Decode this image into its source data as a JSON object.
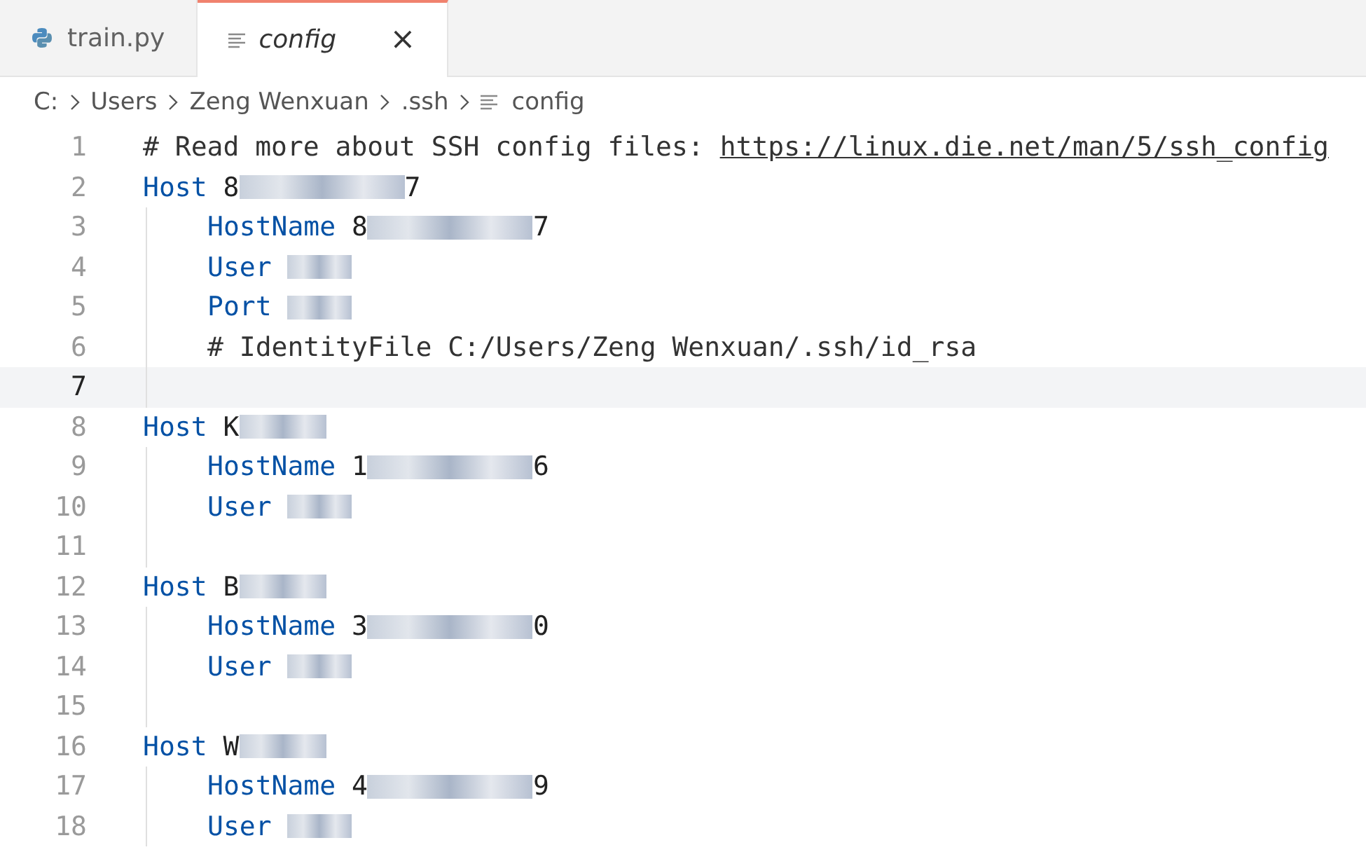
{
  "tabs": [
    {
      "label": "train.py",
      "kind": "python",
      "italic": false,
      "selected": false,
      "closable": false
    },
    {
      "label": "config",
      "kind": "plain",
      "italic": true,
      "selected": true,
      "closable": true,
      "close": "×"
    }
  ],
  "breadcrumb": [
    {
      "label": "C:",
      "icon": false
    },
    {
      "label": "Users",
      "icon": false
    },
    {
      "label": "Zeng Wenxuan",
      "icon": false
    },
    {
      "label": ".ssh",
      "icon": false
    },
    {
      "label": "config",
      "icon": true
    }
  ],
  "lines": [
    {
      "number": "1",
      "kind": "comment",
      "text": "# Read more about SSH config files: ",
      "link": "https://linux.die.net/man/5/ssh_config",
      "selected": false
    },
    {
      "number": "2",
      "kind": "host",
      "keyword": "Host",
      "value_start": "8",
      "redacted": true,
      "value_end": "7",
      "selected": false
    },
    {
      "number": "3",
      "kind": "option",
      "keyword": "HostName",
      "value_start": "8",
      "redacted": true,
      "value_end": "7",
      "selected": false
    },
    {
      "number": "4",
      "kind": "option",
      "keyword": "User",
      "redacted": true,
      "selected": false
    },
    {
      "number": "5",
      "kind": "option",
      "keyword": "Port",
      "redacted": true,
      "selected": false
    },
    {
      "number": "6",
      "kind": "option_comment",
      "text": "# IdentityFile C:/Users/Zeng Wenxuan/.ssh/id_rsa",
      "selected": false
    },
    {
      "number": "7",
      "kind": "blank",
      "selected": true
    },
    {
      "number": "8",
      "kind": "host",
      "keyword": "Host",
      "value_start": "K",
      "redacted": true,
      "selected": false
    },
    {
      "number": "9",
      "kind": "option",
      "keyword": "HostName",
      "value_start": "1",
      "redacted": true,
      "value_end": "6",
      "selected": false
    },
    {
      "number": "10",
      "kind": "option",
      "keyword": "User",
      "redacted": true,
      "selected": false
    },
    {
      "number": "11",
      "kind": "blank",
      "selected": false
    },
    {
      "number": "12",
      "kind": "host",
      "keyword": "Host",
      "value_start": "B",
      "redacted": true,
      "selected": false
    },
    {
      "number": "13",
      "kind": "option",
      "keyword": "HostName",
      "value_start": "3",
      "redacted": true,
      "value_end": "0",
      "selected": false
    },
    {
      "number": "14",
      "kind": "option",
      "keyword": "User",
      "redacted": true,
      "selected": false
    },
    {
      "number": "15",
      "kind": "blank",
      "selected": false
    },
    {
      "number": "16",
      "kind": "host",
      "keyword": "Host",
      "value_start": "W",
      "redacted": true,
      "selected": false
    },
    {
      "number": "17",
      "kind": "option",
      "keyword": "HostName",
      "value_start": "4",
      "redacted": true,
      "value_end": "9",
      "selected": false
    },
    {
      "number": "18",
      "kind": "option",
      "keyword": "User",
      "redacted": true,
      "selected": false
    }
  ]
}
